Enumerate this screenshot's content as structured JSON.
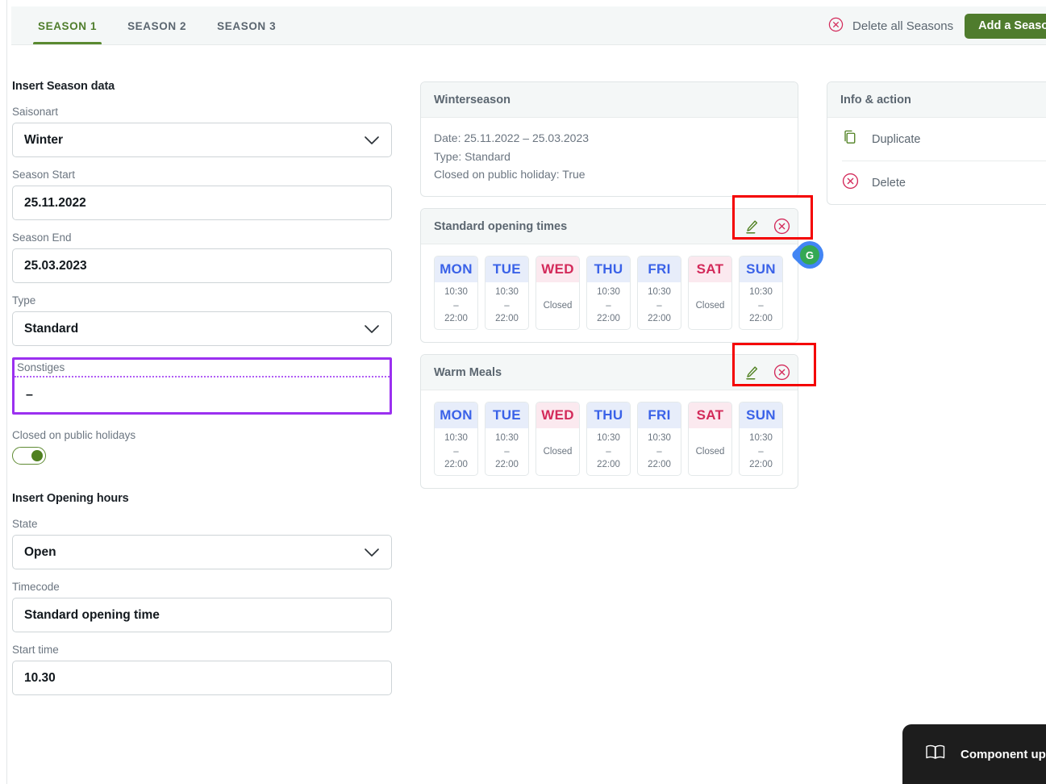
{
  "tabs": [
    {
      "label": "SEASON 1",
      "active": true
    },
    {
      "label": "SEASON 2",
      "active": false
    },
    {
      "label": "SEASON 3",
      "active": false
    }
  ],
  "header": {
    "delete_all_label": "Delete all Seasons",
    "add_season_label": "Add a Season",
    "delete_all_icon": "circle-x-icon",
    "accent_green": "#4f7c2d",
    "accent_red": "#d32a5a"
  },
  "form": {
    "season_section_title": "Insert Season data",
    "saisonart": {
      "label": "Saisonart",
      "value": "Winter",
      "icon": "chevron-down-icon"
    },
    "season_start": {
      "label": "Season Start",
      "value": "25.11.2022"
    },
    "season_end": {
      "label": "Season End",
      "value": "25.03.2023"
    },
    "type": {
      "label": "Type",
      "value": "Standard",
      "icon": "chevron-down-icon"
    },
    "sonstiges": {
      "label": "Sonstiges",
      "value": "–",
      "highlight_color": "#9b30f0"
    },
    "closed_holidays": {
      "label": "Closed on public holidays",
      "state": "on"
    },
    "hours_section_title": "Insert Opening hours",
    "state": {
      "label": "State",
      "value": "Open",
      "icon": "chevron-down-icon"
    },
    "timecode": {
      "label": "Timecode",
      "value": "Standard opening time"
    },
    "start_time": {
      "label": "Start time",
      "value": "10.30"
    }
  },
  "season_card": {
    "title": "Winterseason",
    "date_line": "Date: 25.11.2022 – 25.03.2023",
    "type_line": "Type: Standard",
    "holiday_line": "Closed on public holiday: True"
  },
  "schedules": [
    {
      "title": "Standard opening times",
      "edit_icon": "pencil-icon",
      "delete_icon": "circle-x-icon",
      "days": [
        {
          "name": "MON",
          "open": true,
          "time": "10:30\n–\n22:00",
          "line1": "10:30",
          "line2": "–",
          "line3": "22:00"
        },
        {
          "name": "TUE",
          "open": true,
          "line1": "10:30",
          "line2": "–",
          "line3": "22:00"
        },
        {
          "name": "WED",
          "open": false,
          "line1": "Closed"
        },
        {
          "name": "THU",
          "open": true,
          "line1": "10:30",
          "line2": "–",
          "line3": "22:00"
        },
        {
          "name": "FRI",
          "open": true,
          "line1": "10:30",
          "line2": "–",
          "line3": "22:00"
        },
        {
          "name": "SAT",
          "open": false,
          "line1": "Closed"
        },
        {
          "name": "SUN",
          "open": true,
          "line1": "10:30",
          "line2": "–",
          "line3": "22:00"
        }
      ]
    },
    {
      "title": "Warm Meals",
      "edit_icon": "pencil-icon",
      "delete_icon": "circle-x-icon",
      "days": [
        {
          "name": "MON",
          "open": true,
          "line1": "10:30",
          "line2": "–",
          "line3": "22:00"
        },
        {
          "name": "TUE",
          "open": true,
          "line1": "10:30",
          "line2": "–",
          "line3": "22:00"
        },
        {
          "name": "WED",
          "open": false,
          "line1": "Closed"
        },
        {
          "name": "THU",
          "open": true,
          "line1": "10:30",
          "line2": "–",
          "line3": "22:00"
        },
        {
          "name": "FRI",
          "open": true,
          "line1": "10:30",
          "line2": "–",
          "line3": "22:00"
        },
        {
          "name": "SAT",
          "open": false,
          "line1": "Closed"
        },
        {
          "name": "SUN",
          "open": true,
          "line1": "10:30",
          "line2": "–",
          "line3": "22:00"
        }
      ]
    }
  ],
  "badge": {
    "letter": "G"
  },
  "info_panel": {
    "title": "Info & action",
    "duplicate_label": "Duplicate",
    "duplicate_icon": "copy-icon",
    "delete_label": "Delete",
    "delete_icon": "circle-x-icon"
  },
  "widget": {
    "label": "Component update",
    "icon": "book-icon"
  }
}
